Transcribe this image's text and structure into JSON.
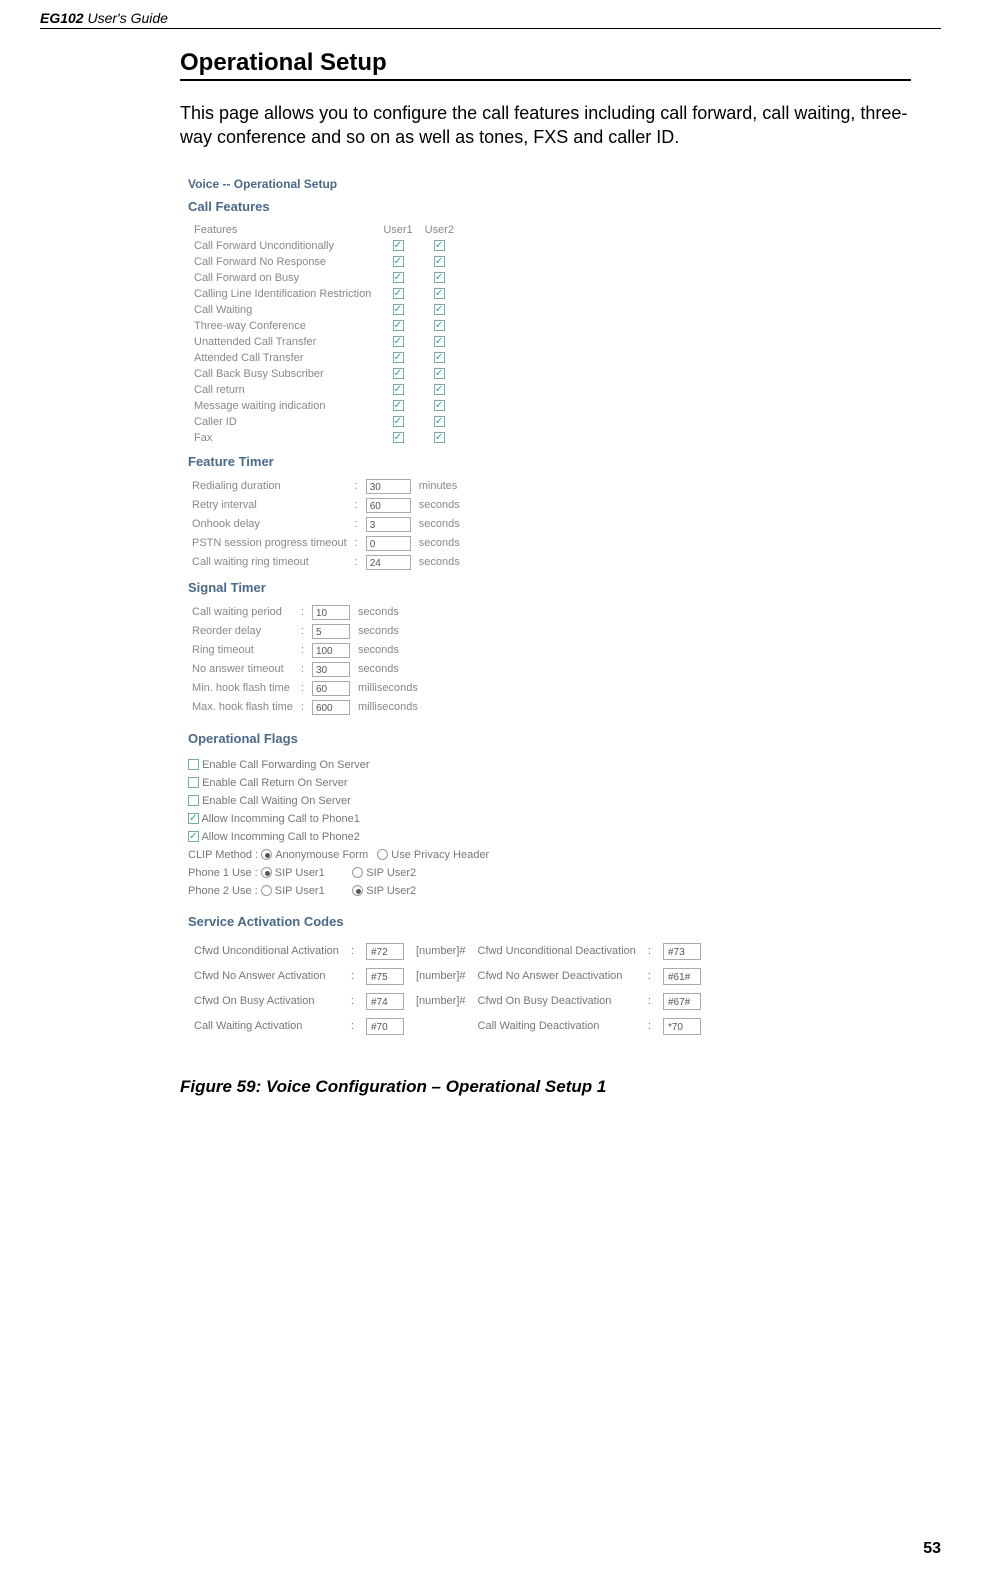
{
  "header": {
    "model": "EG102",
    "guide": " User's Guide"
  },
  "title": "Operational Setup",
  "intro": "This page allows you to configure the call features including call forward, call waiting, three-way conference and so on as well as tones, FXS and caller ID.",
  "screenshot": {
    "top_title": "Voice -- Operational Setup",
    "call_features_title": "Call Features",
    "features_header": {
      "features": "Features",
      "user1": "User1",
      "user2": "User2"
    },
    "features_rows": [
      "Call Forward Unconditionally",
      "Call Forward No Response",
      "Call Forward on Busy",
      "Calling Line Identification Restriction",
      "Call Waiting",
      "Three-way Conference",
      "Unattended Call Transfer",
      "Attended Call Transfer",
      "Call Back Busy Subscriber",
      "Call return",
      "Message waiting indication",
      "Caller ID",
      "Fax"
    ],
    "feature_timer_title": "Feature Timer",
    "feature_timer_rows": [
      {
        "label": "Redialing duration",
        "value": "30",
        "unit": "minutes"
      },
      {
        "label": "Retry interval",
        "value": "60",
        "unit": "seconds"
      },
      {
        "label": "Onhook delay",
        "value": "3",
        "unit": "seconds"
      },
      {
        "label": "PSTN session progress timeout",
        "value": "0",
        "unit": "seconds"
      },
      {
        "label": "Call waiting ring timeout",
        "value": "24",
        "unit": "seconds"
      }
    ],
    "signal_timer_title": "Signal Timer",
    "signal_timer_rows": [
      {
        "label": "Call waiting period",
        "value": "10",
        "unit": "seconds"
      },
      {
        "label": "Reorder delay",
        "value": "5",
        "unit": "seconds"
      },
      {
        "label": "Ring timeout",
        "value": "100",
        "unit": "seconds"
      },
      {
        "label": "No answer timeout",
        "value": "30",
        "unit": "seconds"
      },
      {
        "label": "Min. hook flash time",
        "value": "60",
        "unit": "milliseconds"
      },
      {
        "label": "Max. hook flash time",
        "value": "600",
        "unit": "milliseconds"
      }
    ],
    "operational_flags_title": "Operational Flags",
    "flags": [
      {
        "label": "Enable Call Forwarding On Server",
        "checked": false
      },
      {
        "label": "Enable Call Return On Server",
        "checked": false
      },
      {
        "label": "Enable Call Waiting On Server",
        "checked": false
      },
      {
        "label": "Allow Incomming Call to Phone1",
        "checked": true
      },
      {
        "label": "Allow Incomming Call to Phone2",
        "checked": true
      }
    ],
    "clip": {
      "label": "CLIP Method :",
      "opt1": "Anonymouse Form",
      "opt2": "Use Privacy Header",
      "selected": 0
    },
    "phone1": {
      "label": "Phone 1 Use :",
      "opt1": "SIP User1",
      "opt2": "SIP User2",
      "selected": 0
    },
    "phone2": {
      "label": "Phone 2 Use :",
      "opt1": "SIP User1",
      "opt2": "SIP User2",
      "selected": 1
    },
    "service_activation_title": "Service Activation Codes",
    "service_rows": [
      {
        "label1": "Cfwd Unconditional Activation",
        "v1": "#72",
        "suffix": "[number]#",
        "label2": "Cfwd Unconditional Deactivation",
        "v2": "#73"
      },
      {
        "label1": "Cfwd No Answer Activation",
        "v1": "#75",
        "suffix": "[number]#",
        "label2": "Cfwd No Answer Deactivation",
        "v2": "#61#"
      },
      {
        "label1": "Cfwd On Busy Activation",
        "v1": "#74",
        "suffix": "[number]#",
        "label2": "Cfwd On Busy Deactivation",
        "v2": "#67#"
      },
      {
        "label1": "Call Waiting Activation",
        "v1": "#70",
        "suffix": "",
        "label2": "Call Waiting Deactivation",
        "v2": "*70"
      }
    ]
  },
  "figure_caption": "Figure 59: Voice Configuration – Operational Setup 1",
  "page_number": "53"
}
